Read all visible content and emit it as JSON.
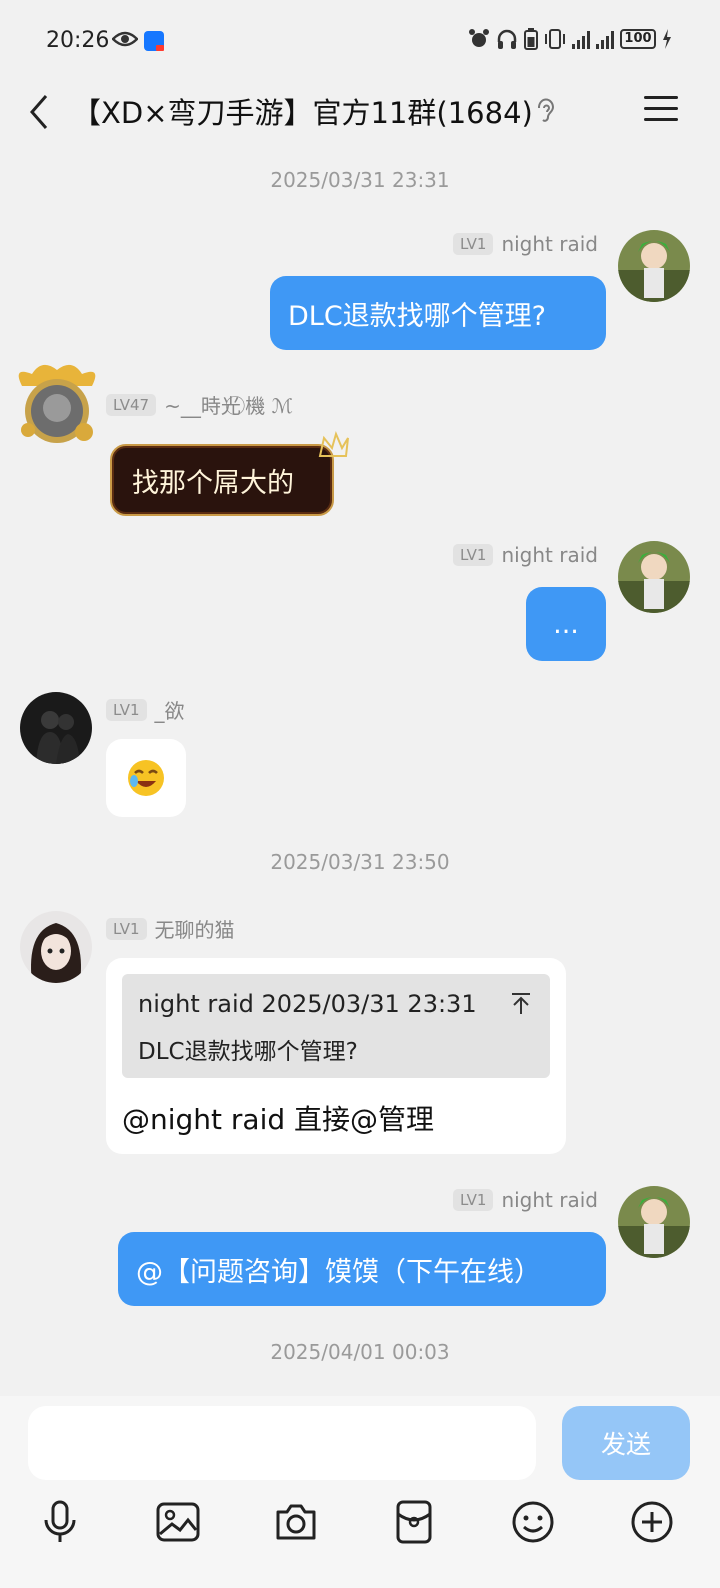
{
  "status_bar": {
    "time": "20:26",
    "battery": "100"
  },
  "header": {
    "title": "【XD×弯刀手游】官方11群(1684)"
  },
  "messages": [
    {
      "type": "timestamp",
      "text": "2025/03/31 23:31"
    },
    {
      "type": "outgoing",
      "level": "LV1",
      "sender": "night raid",
      "text": "DLC退款找哪个管理?"
    },
    {
      "type": "incoming",
      "level": "LV47",
      "sender": "~__時光 ⃝機 ℳ",
      "text": "找那个屌大的"
    },
    {
      "type": "outgoing",
      "level": "LV1",
      "sender": "night raid",
      "text": "..."
    },
    {
      "type": "incoming",
      "level": "LV1",
      "sender": "_欲",
      "content": "sticker-emoji"
    },
    {
      "type": "timestamp",
      "text": "2025/03/31 23:50"
    },
    {
      "type": "incoming",
      "level": "LV1",
      "sender": "无聊的猫",
      "quote": {
        "header": "night raid  2025/03/31 23:31",
        "text": "DLC退款找哪个管理?"
      },
      "text": "@night raid 直接@管理"
    },
    {
      "type": "outgoing",
      "level": "LV1",
      "sender": "night raid",
      "text": "@【问题咨询】馍馍（下午在线）"
    },
    {
      "type": "timestamp",
      "text": "2025/04/01 00:03"
    }
  ],
  "input": {
    "value": "",
    "send_label": "发送"
  },
  "colors": {
    "outgoing_bubble": "#3f98f5",
    "send_button": "#95c6f7",
    "background": "#f1f1f1"
  }
}
